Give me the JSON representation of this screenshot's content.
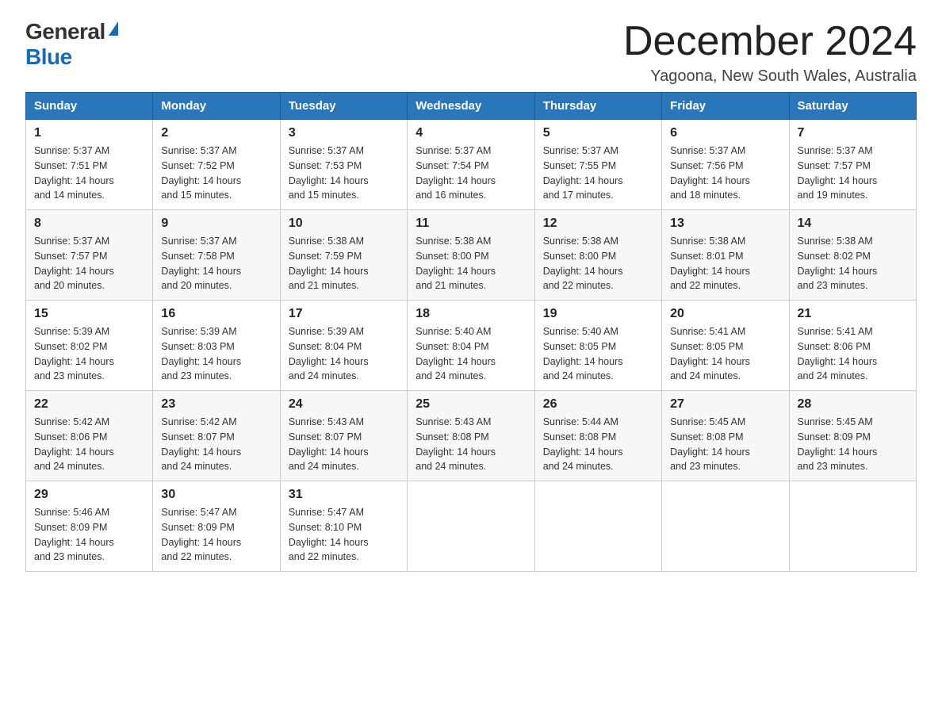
{
  "logo": {
    "general": "General",
    "blue": "Blue"
  },
  "title": "December 2024",
  "location": "Yagoona, New South Wales, Australia",
  "days_of_week": [
    "Sunday",
    "Monday",
    "Tuesday",
    "Wednesday",
    "Thursday",
    "Friday",
    "Saturday"
  ],
  "weeks": [
    [
      {
        "day": "1",
        "sunrise": "5:37 AM",
        "sunset": "7:51 PM",
        "daylight": "14 hours and 14 minutes."
      },
      {
        "day": "2",
        "sunrise": "5:37 AM",
        "sunset": "7:52 PM",
        "daylight": "14 hours and 15 minutes."
      },
      {
        "day": "3",
        "sunrise": "5:37 AM",
        "sunset": "7:53 PM",
        "daylight": "14 hours and 15 minutes."
      },
      {
        "day": "4",
        "sunrise": "5:37 AM",
        "sunset": "7:54 PM",
        "daylight": "14 hours and 16 minutes."
      },
      {
        "day": "5",
        "sunrise": "5:37 AM",
        "sunset": "7:55 PM",
        "daylight": "14 hours and 17 minutes."
      },
      {
        "day": "6",
        "sunrise": "5:37 AM",
        "sunset": "7:56 PM",
        "daylight": "14 hours and 18 minutes."
      },
      {
        "day": "7",
        "sunrise": "5:37 AM",
        "sunset": "7:57 PM",
        "daylight": "14 hours and 19 minutes."
      }
    ],
    [
      {
        "day": "8",
        "sunrise": "5:37 AM",
        "sunset": "7:57 PM",
        "daylight": "14 hours and 20 minutes."
      },
      {
        "day": "9",
        "sunrise": "5:37 AM",
        "sunset": "7:58 PM",
        "daylight": "14 hours and 20 minutes."
      },
      {
        "day": "10",
        "sunrise": "5:38 AM",
        "sunset": "7:59 PM",
        "daylight": "14 hours and 21 minutes."
      },
      {
        "day": "11",
        "sunrise": "5:38 AM",
        "sunset": "8:00 PM",
        "daylight": "14 hours and 21 minutes."
      },
      {
        "day": "12",
        "sunrise": "5:38 AM",
        "sunset": "8:00 PM",
        "daylight": "14 hours and 22 minutes."
      },
      {
        "day": "13",
        "sunrise": "5:38 AM",
        "sunset": "8:01 PM",
        "daylight": "14 hours and 22 minutes."
      },
      {
        "day": "14",
        "sunrise": "5:38 AM",
        "sunset": "8:02 PM",
        "daylight": "14 hours and 23 minutes."
      }
    ],
    [
      {
        "day": "15",
        "sunrise": "5:39 AM",
        "sunset": "8:02 PM",
        "daylight": "14 hours and 23 minutes."
      },
      {
        "day": "16",
        "sunrise": "5:39 AM",
        "sunset": "8:03 PM",
        "daylight": "14 hours and 23 minutes."
      },
      {
        "day": "17",
        "sunrise": "5:39 AM",
        "sunset": "8:04 PM",
        "daylight": "14 hours and 24 minutes."
      },
      {
        "day": "18",
        "sunrise": "5:40 AM",
        "sunset": "8:04 PM",
        "daylight": "14 hours and 24 minutes."
      },
      {
        "day": "19",
        "sunrise": "5:40 AM",
        "sunset": "8:05 PM",
        "daylight": "14 hours and 24 minutes."
      },
      {
        "day": "20",
        "sunrise": "5:41 AM",
        "sunset": "8:05 PM",
        "daylight": "14 hours and 24 minutes."
      },
      {
        "day": "21",
        "sunrise": "5:41 AM",
        "sunset": "8:06 PM",
        "daylight": "14 hours and 24 minutes."
      }
    ],
    [
      {
        "day": "22",
        "sunrise": "5:42 AM",
        "sunset": "8:06 PM",
        "daylight": "14 hours and 24 minutes."
      },
      {
        "day": "23",
        "sunrise": "5:42 AM",
        "sunset": "8:07 PM",
        "daylight": "14 hours and 24 minutes."
      },
      {
        "day": "24",
        "sunrise": "5:43 AM",
        "sunset": "8:07 PM",
        "daylight": "14 hours and 24 minutes."
      },
      {
        "day": "25",
        "sunrise": "5:43 AM",
        "sunset": "8:08 PM",
        "daylight": "14 hours and 24 minutes."
      },
      {
        "day": "26",
        "sunrise": "5:44 AM",
        "sunset": "8:08 PM",
        "daylight": "14 hours and 24 minutes."
      },
      {
        "day": "27",
        "sunrise": "5:45 AM",
        "sunset": "8:08 PM",
        "daylight": "14 hours and 23 minutes."
      },
      {
        "day": "28",
        "sunrise": "5:45 AM",
        "sunset": "8:09 PM",
        "daylight": "14 hours and 23 minutes."
      }
    ],
    [
      {
        "day": "29",
        "sunrise": "5:46 AM",
        "sunset": "8:09 PM",
        "daylight": "14 hours and 23 minutes."
      },
      {
        "day": "30",
        "sunrise": "5:47 AM",
        "sunset": "8:09 PM",
        "daylight": "14 hours and 22 minutes."
      },
      {
        "day": "31",
        "sunrise": "5:47 AM",
        "sunset": "8:10 PM",
        "daylight": "14 hours and 22 minutes."
      },
      null,
      null,
      null,
      null
    ]
  ],
  "labels": {
    "sunrise": "Sunrise:",
    "sunset": "Sunset:",
    "daylight": "Daylight:"
  }
}
